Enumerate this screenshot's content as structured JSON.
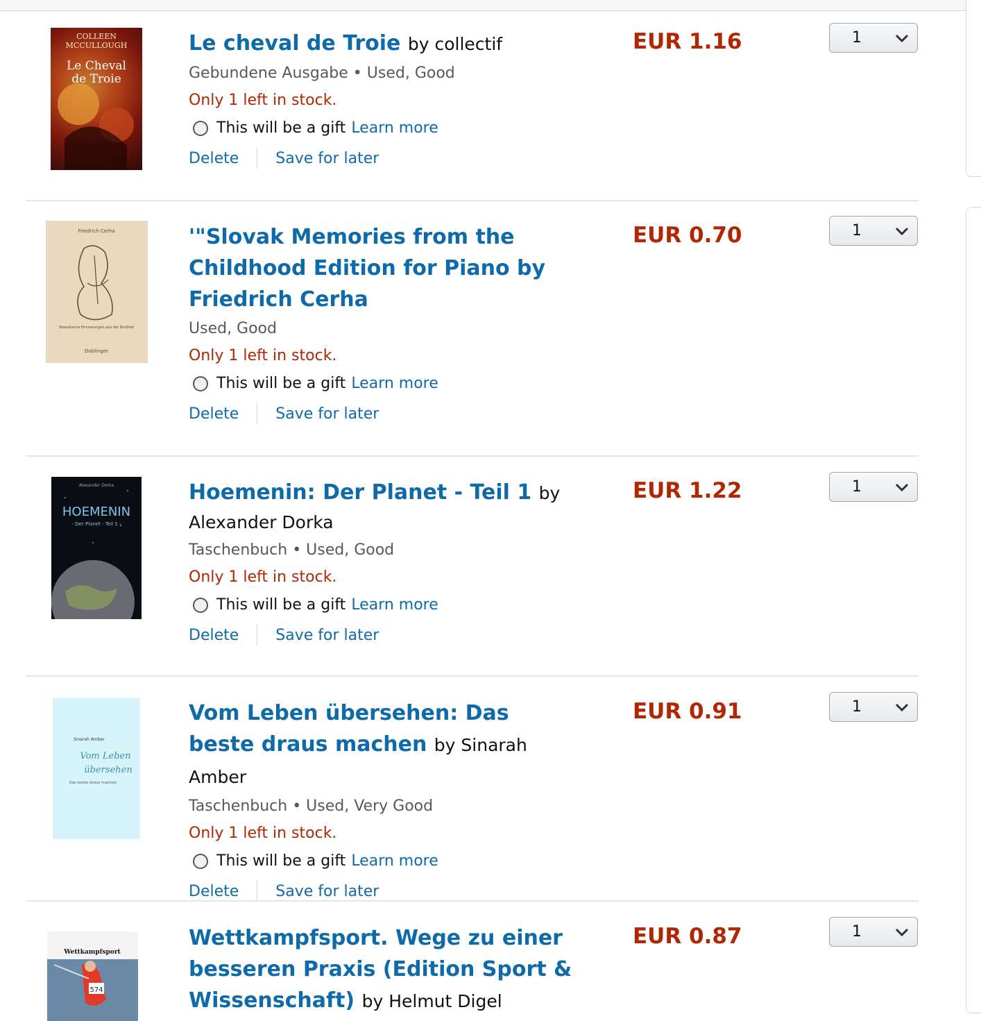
{
  "colors": {
    "link": "#0e6aa8",
    "price": "#b12704",
    "stock": "#b12704",
    "secondary": "#565959"
  },
  "common": {
    "gift_label": "This will be a gift",
    "learn_more": "Learn more",
    "delete": "Delete",
    "save_for_later": "Save for later",
    "stock": "Only 1 left in stock."
  },
  "items": [
    {
      "title": "Le cheval de Troie",
      "by": "by collectif",
      "format": "Gebundene Ausgabe • Used, Good",
      "price": "EUR 1.16",
      "qty": "1",
      "cover": {
        "line1": "COLLEEN",
        "line2": "MCCULLOUGH",
        "line3": "Le Cheval",
        "line4": "de Troie"
      }
    },
    {
      "title": "'\"Slovak Memories from the Childhood Edition for Piano by Friedrich Cerha",
      "format": "Used, Good",
      "price": "EUR 0.70",
      "qty": "1",
      "cover": {
        "line1": "Friedrich Cerha",
        "line2": "Slowakische Erinnerungen aus der Kindheit",
        "line3": "Doblinger"
      }
    },
    {
      "title": "Hoemenin: Der Planet - Teil 1",
      "by": "by",
      "author": "Alexander Dorka",
      "format": "Taschenbuch • Used, Good",
      "price": "EUR 1.22",
      "qty": "1",
      "cover": {
        "line1": "Alexander Dorka",
        "line2": "HOEMENIN",
        "line3": "- Der Planet - Teil 1 -"
      }
    },
    {
      "title": "Vom Leben übersehen: Das beste draus machen",
      "by": "by Sinarah Amber",
      "format": "Taschenbuch • Used, Very Good",
      "price": "EUR 0.91",
      "qty": "1",
      "cover": {
        "line1": "Sinarah Amber",
        "line2": "Vom Leben",
        "line3": "übersehen",
        "line4": "Das beste draus machen"
      }
    },
    {
      "title": "Wettkampfsport. Wege zu einer besseren Praxis (Edition Sport & Wissenschaft)",
      "by": "by Helmut Digel",
      "price": "EUR 0.87",
      "qty": "1",
      "cover": {
        "line1": "Wettkampfsport",
        "line2": "574"
      }
    }
  ]
}
